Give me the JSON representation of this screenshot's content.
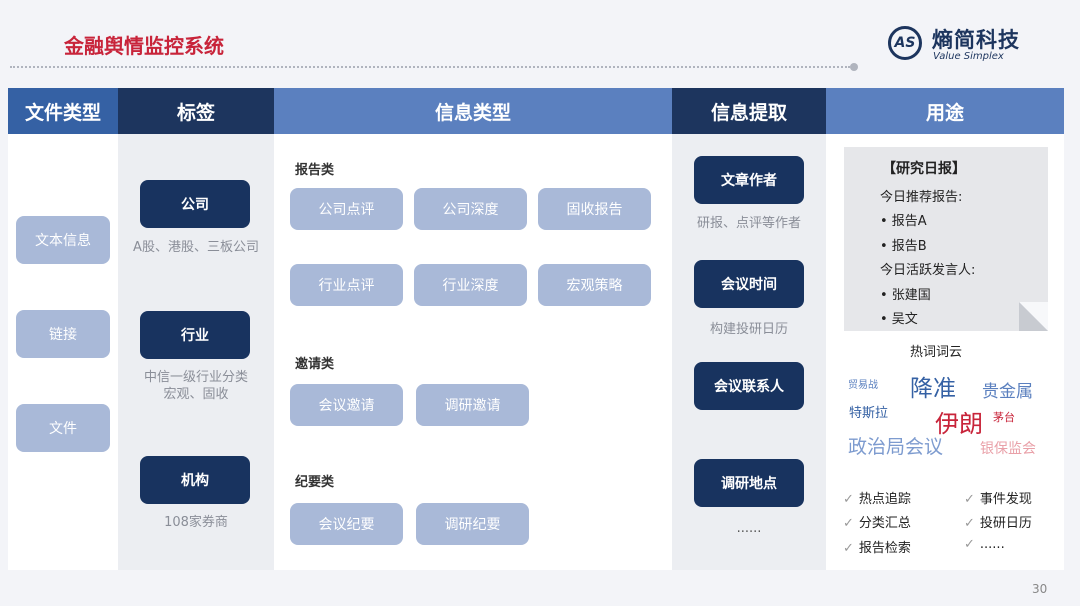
{
  "page": {
    "title": "金融舆情监控系统",
    "number": "30"
  },
  "logo": {
    "mark": "AS",
    "name_cn": "熵简科技",
    "name_en": "Value Simplex"
  },
  "columns": [
    {
      "label": "文件类型",
      "color": "#3561a4"
    },
    {
      "label": "标签",
      "color": "#1d355e"
    },
    {
      "label": "信息类型",
      "color": "#5b80bf"
    },
    {
      "label": "信息提取",
      "color": "#1d355e"
    },
    {
      "label": "用途",
      "color": "#5b80bf"
    }
  ],
  "file_types": [
    "文本信息",
    "链接",
    "文件"
  ],
  "tags": [
    {
      "label": "公司",
      "caption": "A股、港股、三板公司"
    },
    {
      "label": "行业",
      "caption": "中信一级行业分类\n宏观、固收"
    },
    {
      "label": "机构",
      "caption": "108家券商"
    }
  ],
  "info_types": {
    "report": {
      "label": "报告类",
      "items": [
        "公司点评",
        "公司深度",
        "固收报告",
        "行业点评",
        "行业深度",
        "宏观策略"
      ]
    },
    "invite": {
      "label": "邀请类",
      "items": [
        "会议邀请",
        "调研邀请"
      ]
    },
    "minutes": {
      "label": "纪要类",
      "items": [
        "会议纪要",
        "调研纪要"
      ]
    }
  },
  "extraction": [
    {
      "label": "文章作者",
      "caption": "研报、点评等作者"
    },
    {
      "label": "会议时间",
      "caption": "构建投研日历"
    },
    {
      "label": "会议联系人",
      "caption": ""
    },
    {
      "label": "调研地点",
      "caption": "......"
    }
  ],
  "usage": {
    "report_title": "【研究日报】",
    "lines": [
      "今日推荐报告:",
      "•  报告A",
      "•  报告B",
      "今日活跃发言人:",
      "•  张建国",
      "•  吴文"
    ],
    "wordcloud_title": "热词词云",
    "words": [
      {
        "text": "贸易战",
        "color": "#5b80bf"
      },
      {
        "text": "降准",
        "color": "#3561a4"
      },
      {
        "text": "贵金属",
        "color": "#5b80bf"
      },
      {
        "text": "特斯拉",
        "color": "#3561a4"
      },
      {
        "text": "伊朗",
        "color": "#c8243a"
      },
      {
        "text": "茅台",
        "color": "#c8243a"
      },
      {
        "text": "政治局会议",
        "color": "#7d9bcf"
      },
      {
        "text": "银保监会",
        "color": "#e9a0a8"
      }
    ],
    "checks": [
      "热点追踪",
      "事件发现",
      "分类汇总",
      "投研日历",
      "报告检索",
      "......"
    ]
  }
}
